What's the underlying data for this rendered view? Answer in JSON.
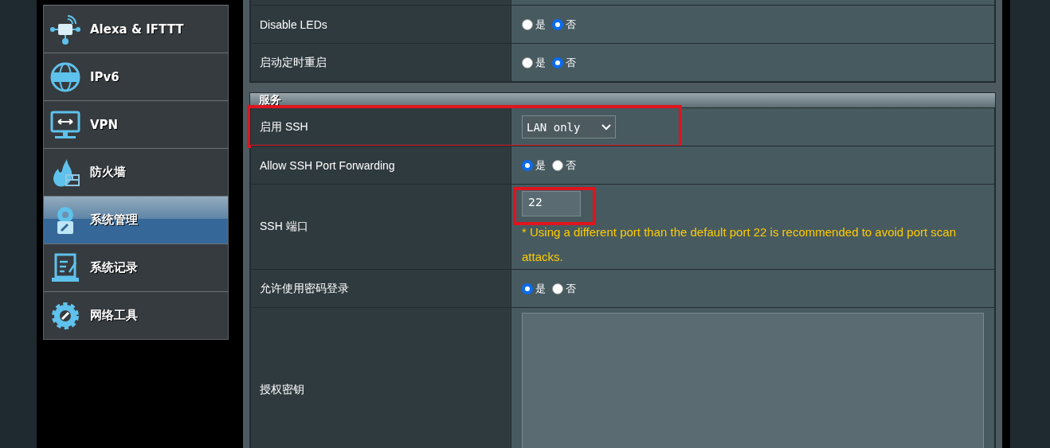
{
  "sidebar": {
    "items": [
      {
        "label": "Alexa & IFTTT",
        "selected": false
      },
      {
        "label": "IPv6",
        "selected": false
      },
      {
        "label": "VPN",
        "selected": false
      },
      {
        "label": "防火墙",
        "selected": false
      },
      {
        "label": "系统管理",
        "selected": true
      },
      {
        "label": "系统记录",
        "selected": false
      },
      {
        "label": "网络工具",
        "selected": false
      }
    ]
  },
  "system_rows": [
    {
      "label": "Disable LEDs",
      "kind": "radio",
      "options": [
        {
          "label": "是",
          "selected": false
        },
        {
          "label": "否",
          "selected": true
        }
      ]
    },
    {
      "label": "启动定时重启",
      "kind": "radio",
      "options": [
        {
          "label": "是",
          "selected": false
        },
        {
          "label": "否",
          "selected": true
        }
      ]
    }
  ],
  "services": {
    "title": "服务",
    "rows": [
      {
        "label": "启用 SSH",
        "kind": "select",
        "value": "LAN only",
        "highlighted": true
      },
      {
        "label": "Allow SSH Port Forwarding",
        "kind": "radio",
        "options": [
          {
            "label": "是",
            "selected": true
          },
          {
            "label": "否",
            "selected": false
          }
        ],
        "highlighted": false
      },
      {
        "label": "SSH 端口",
        "kind": "text",
        "value": "22",
        "hint": "* Using a different port than the default port 22 is recommended to avoid port scan attacks.",
        "highlighted": true
      },
      {
        "label": "允许使用密码登录",
        "kind": "radio",
        "options": [
          {
            "label": "是",
            "selected": true
          },
          {
            "label": "否",
            "selected": false
          }
        ],
        "highlighted": false
      },
      {
        "label": "授权密钥",
        "kind": "textarea",
        "highlighted": false
      }
    ]
  }
}
